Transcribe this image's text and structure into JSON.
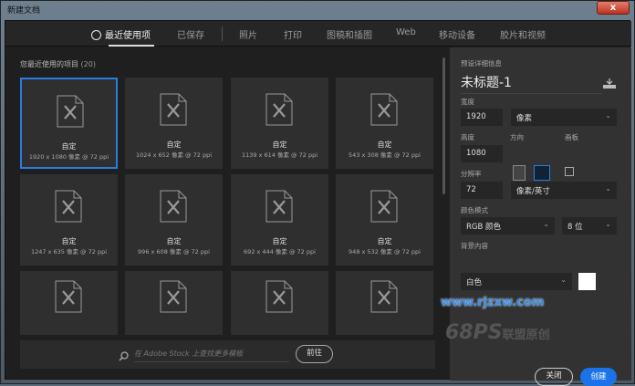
{
  "window": {
    "title": "新建文档",
    "close": "x"
  },
  "tabs": [
    {
      "label": "最近使用项"
    },
    {
      "label": "已保存"
    },
    {
      "label": "照片"
    },
    {
      "label": "打印"
    },
    {
      "label": "图稿和插图"
    },
    {
      "label": "Web"
    },
    {
      "label": "移动设备"
    },
    {
      "label": "胶片和视频"
    }
  ],
  "recent": {
    "heading": "您最近使用的项目",
    "count": "(20)",
    "items": [
      {
        "name": "自定",
        "size": "1920 x 1080 像素 @ 72 ppi"
      },
      {
        "name": "自定",
        "size": "1024 x 652 像素 @ 72 ppi"
      },
      {
        "name": "自定",
        "size": "1139 x 614 像素 @ 72 ppi"
      },
      {
        "name": "自定",
        "size": "543 x 308 像素 @ 72 ppi"
      },
      {
        "name": "自定",
        "size": "1247 x 635 像素 @ 72 ppi"
      },
      {
        "name": "自定",
        "size": "996 x 608 像素 @ 72 ppi"
      },
      {
        "name": "自定",
        "size": "692 x 444 像素 @ 72 ppi"
      },
      {
        "name": "自定",
        "size": "948 x 532 像素 @ 72 ppi"
      }
    ]
  },
  "search": {
    "placeholder": "在 Adobe Stock 上查找更多模板",
    "go": "前往"
  },
  "details": {
    "heading": "预设详细信息",
    "doc_title": "未标题-1",
    "width_label": "宽度",
    "width": "1920",
    "width_unit": "像素",
    "height_label": "高度",
    "height": "1080",
    "orientation_label": "方向",
    "artboard_label": "画板",
    "resolution_label": "分辨率",
    "resolution": "72",
    "resolution_unit": "像素/英寸",
    "color_mode_label": "颜色模式",
    "color_mode": "RGB 颜色",
    "bit_depth": "8 位",
    "bg_label": "背景内容",
    "bg": "白色",
    "bg_color": "#ffffff"
  },
  "watermark": {
    "url": "www.rjzxw.com",
    "brand": "68PS",
    "brand_suffix": "联盟原创"
  },
  "buttons": {
    "close": "关闭",
    "create": "创建"
  }
}
